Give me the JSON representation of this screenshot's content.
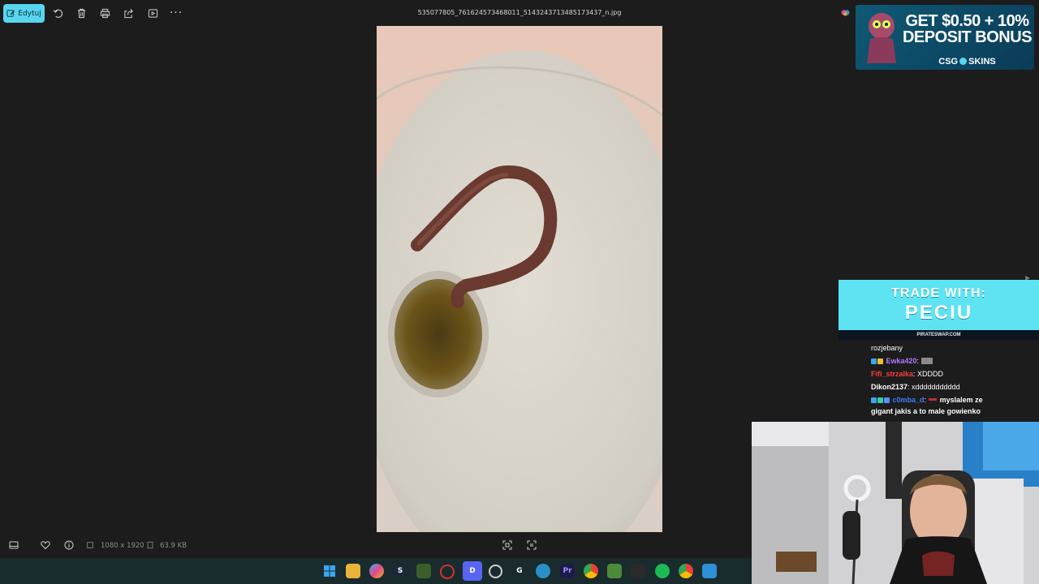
{
  "toolbar": {
    "edit_label": "Edytuj",
    "file_name": "535077805_761624573468011_5143243713485173437_n.jpg"
  },
  "info": {
    "dimensions": "1080 x 1920",
    "file_size": "63.9 KB"
  },
  "ad": {
    "line1": "GET $0.50 + 10%",
    "line2": "DEPOSIT BONUS",
    "brand_left": "CSG",
    "brand_right": "SKINS"
  },
  "trade": {
    "line1": "TRADE WITH:",
    "line2": "PECIU",
    "url": "PIRATESWAP.COM"
  },
  "chat": {
    "messages": [
      {
        "user": "",
        "text": "rozjebany",
        "color": "#ffffff"
      },
      {
        "user": "Ewka420",
        "text": ": ",
        "color": "#b07cff"
      },
      {
        "user": "Fifi_strzalka",
        "text": ": XDDDD",
        "color": "#ff3b3b"
      },
      {
        "user": "Dikon2137",
        "text": ": xddddddddddd",
        "color": "#ffffff"
      },
      {
        "user": "c0mba_d",
        "text": ": ",
        "color": "#3d7bff"
      },
      {
        "user": "",
        "text": "myslalem ze",
        "color": "#ffffff"
      },
      {
        "user": "",
        "text": "gigant jakis a to male gowienko",
        "color": "#ffffff"
      }
    ]
  },
  "colors": {
    "accent": "#58d6f0",
    "background": "#1c1c1c",
    "taskbar": "#1a2b2d"
  }
}
